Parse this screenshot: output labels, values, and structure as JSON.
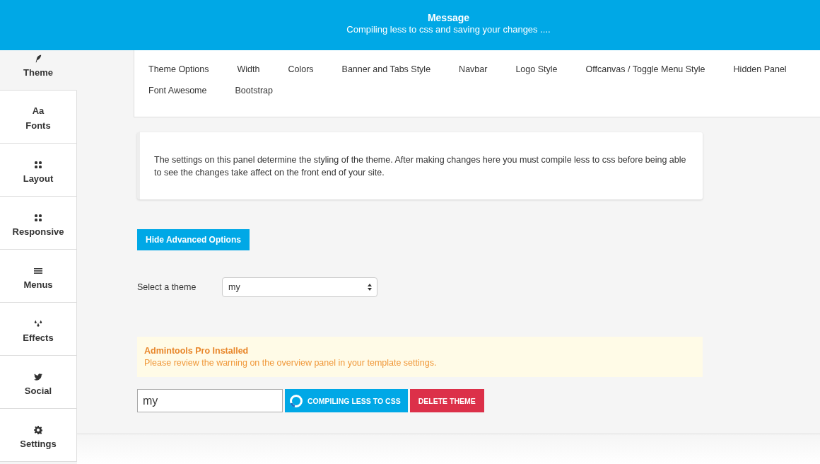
{
  "message": {
    "title": "Message",
    "text": "Compiling less to css and saving your changes ...."
  },
  "sidebar": {
    "items": [
      {
        "label": "Theme",
        "kind": "feather",
        "selected": true
      },
      {
        "label": "Fonts",
        "kind": "letters",
        "icon_text": "Aa",
        "selected": false
      },
      {
        "label": "Layout",
        "kind": "grid",
        "selected": false
      },
      {
        "label": "Responsive",
        "kind": "grid",
        "selected": false
      },
      {
        "label": "Menus",
        "kind": "bars",
        "selected": false
      },
      {
        "label": "Effects",
        "kind": "drops",
        "selected": false
      },
      {
        "label": "Social",
        "kind": "bird",
        "selected": false
      },
      {
        "label": "Settings",
        "kind": "gear",
        "selected": false
      }
    ]
  },
  "tab_rows": [
    [
      "Theme Options",
      "Width",
      "Colors",
      "Banner and Tabs Style",
      "Navbar",
      "Logo Style",
      "Offcanvas / Toggle Menu Style",
      "Hidden Panel"
    ],
    [
      "Font Awesome",
      "Bootstrap"
    ]
  ],
  "info": "The settings on this panel determine the styling of the theme. After making changes here you must compile less to css before being able to see the changes take affect on the front end of your site.",
  "advanced_button": "Hide Advanced Options",
  "theme_select": {
    "label": "Select a theme",
    "value": "my"
  },
  "warning": {
    "title": "Admintools Pro Installed",
    "text": "Please review the warning on the overview panel in your template settings."
  },
  "theme_name": {
    "value": "my"
  },
  "compile_button": {
    "label": "COMPILING LESS TO CSS",
    "busy": true
  },
  "delete_button": "DELETE THEME"
}
